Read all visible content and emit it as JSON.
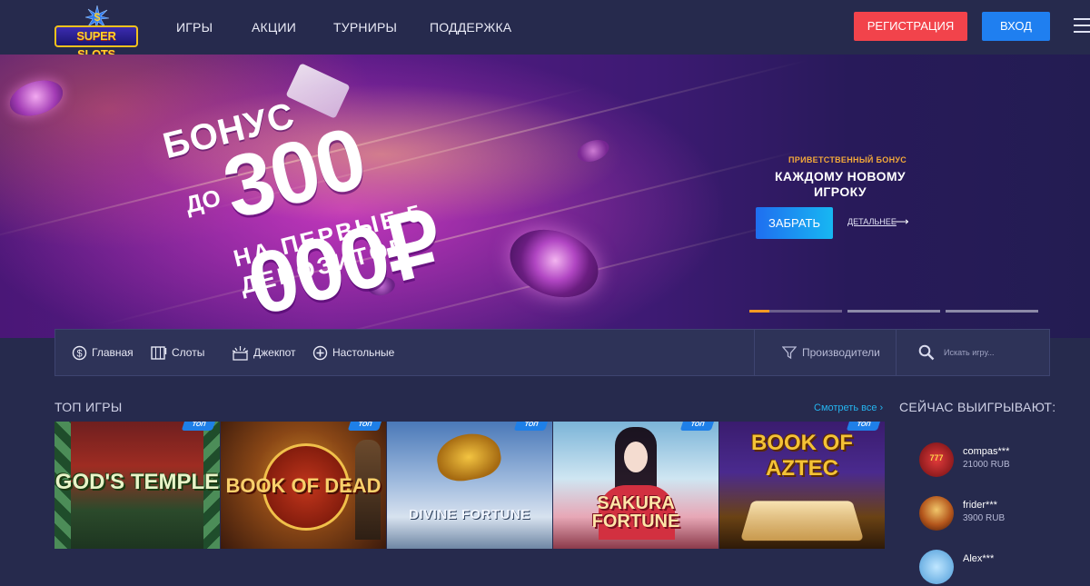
{
  "header": {
    "logo_text": "SUPER SLOTS",
    "nav": [
      "ИГРЫ",
      "АКЦИИ",
      "ТУРНИРЫ",
      "ПОДДЕРЖКА"
    ],
    "register_label": "РЕГИСТРАЦИЯ",
    "login_label": "ВХОД",
    "menu_icon": "hamburger-icon"
  },
  "banner": {
    "bonus_label": "БОНУС",
    "prefix": "ДО",
    "amount": "300 000₽",
    "subtitle": "НА ПЕРВЫЕ 5 ДЕПОЗИТОВ",
    "side_small": "ПРИВЕТСТВЕННЫЙ БОНУС",
    "side_title_line1": "КАЖДОМУ НОВОМУ",
    "side_title_line2": "ИГРОКУ",
    "take_button": "ЗАБРАТЬ",
    "more_link": "ДЕТАЛЬНЕЕ",
    "slides": 3,
    "active_slide": 1,
    "progress": 0.22,
    "colors": {
      "accent": "#f59a23",
      "button": "#1f7ff0"
    }
  },
  "categories": {
    "items": [
      {
        "label": "Главная",
        "icon": "dollar-icon"
      },
      {
        "label": "Слоты",
        "icon": "slot-icon"
      },
      {
        "label": "Джекпот",
        "icon": "jackpot-icon"
      },
      {
        "label": "Настольные",
        "icon": "plus-circle-icon"
      }
    ],
    "filter_label": "Производители",
    "search_placeholder": "Искать игру..."
  },
  "games": {
    "title": "ТОП ИГРЫ",
    "see_all": "Смотреть все",
    "badge": "ТОП",
    "items": [
      {
        "title": "GOD'S TEMPLE"
      },
      {
        "title": "BOOK OF DEAD"
      },
      {
        "title": "DIVINE FORTUNE"
      },
      {
        "title": "SAKURA FORTUNE"
      },
      {
        "title": "BOOK OF AZTEC"
      }
    ]
  },
  "winners": {
    "title": "СЕЙЧАС ВЫИГРЫВАЮТ:",
    "items": [
      {
        "name": "compas***",
        "amount": "21000 RUB"
      },
      {
        "name": "frider***",
        "amount": "3900 RUB"
      },
      {
        "name": "Alex***",
        "amount": ""
      }
    ]
  },
  "colors": {
    "background": "#262a4d",
    "register": "#f2434b",
    "login": "#1f7ff0",
    "link": "#25b4ef"
  }
}
